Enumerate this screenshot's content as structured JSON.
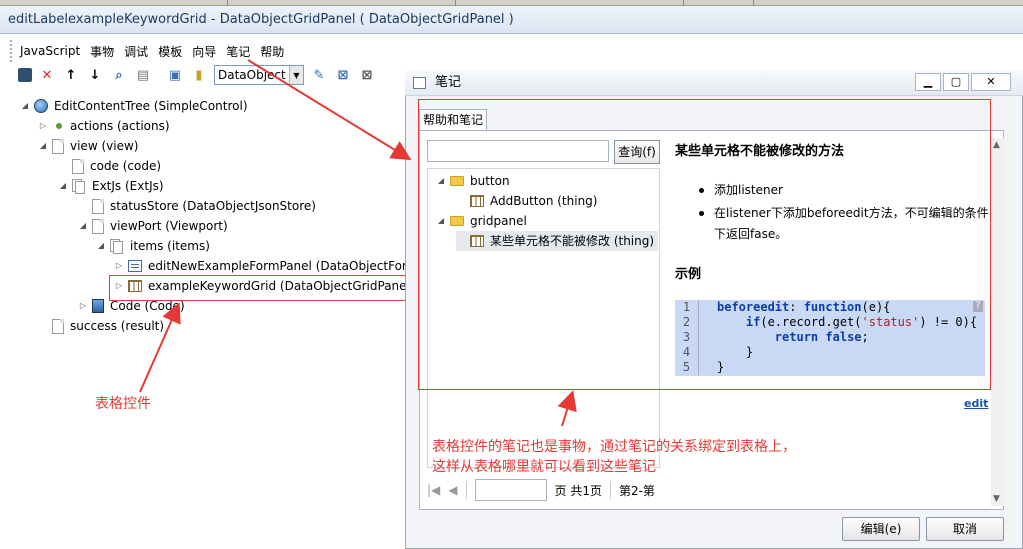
{
  "window_title": "editLabelexampleKeywordGrid - DataObjectGridPanel ( DataObjectGridPanel )",
  "menu": [
    "JavaScript",
    "事物",
    "调试",
    "模板",
    "向导",
    "笔记",
    "帮助"
  ],
  "toolbar": {
    "combo_value": "DataObject"
  },
  "tree": [
    "EditContentTree (SimpleControl)",
    "actions (actions)",
    "view (view)",
    "code (code)",
    "ExtJs (ExtJs)",
    "statusStore (DataObjectJsonStore)",
    "viewPort (Viewport)",
    "items (items)",
    "editNewExampleFormPanel (DataObjectForm",
    "exampleKeywordGrid (DataObjectGridPanel",
    "Code (Code)",
    "success (result)"
  ],
  "annotations": {
    "grid_control": "表格控件",
    "note_line1": "表格控件的笔记也是事物，通过笔记的关系绑定到表格上，",
    "note_line2": "这样从表格哪里就可以看到这些笔记"
  },
  "dialog": {
    "title": "笔记",
    "tab": "帮助和笔记",
    "search_button": "查询(f)",
    "note_tree": {
      "folder1": "button",
      "item1": "AddButton (thing)",
      "folder2": "gridpanel",
      "item2": "某些单元格不能被修改 (thing)"
    },
    "content": {
      "title": "某些单元格不能被修改的方法",
      "bullet1": "添加listener",
      "bullet2": "在listener下添加beforeedit方法，不可编辑的条件下返回fase。",
      "example_title": "示例",
      "code_numbers": [
        "1",
        "2",
        "3",
        "4",
        "5"
      ],
      "edit_link": "edit"
    },
    "pager": {
      "page_label": "页 共1页",
      "page2": "第2-第"
    },
    "buttons": {
      "edit": "编辑(e)",
      "cancel": "取消"
    }
  }
}
